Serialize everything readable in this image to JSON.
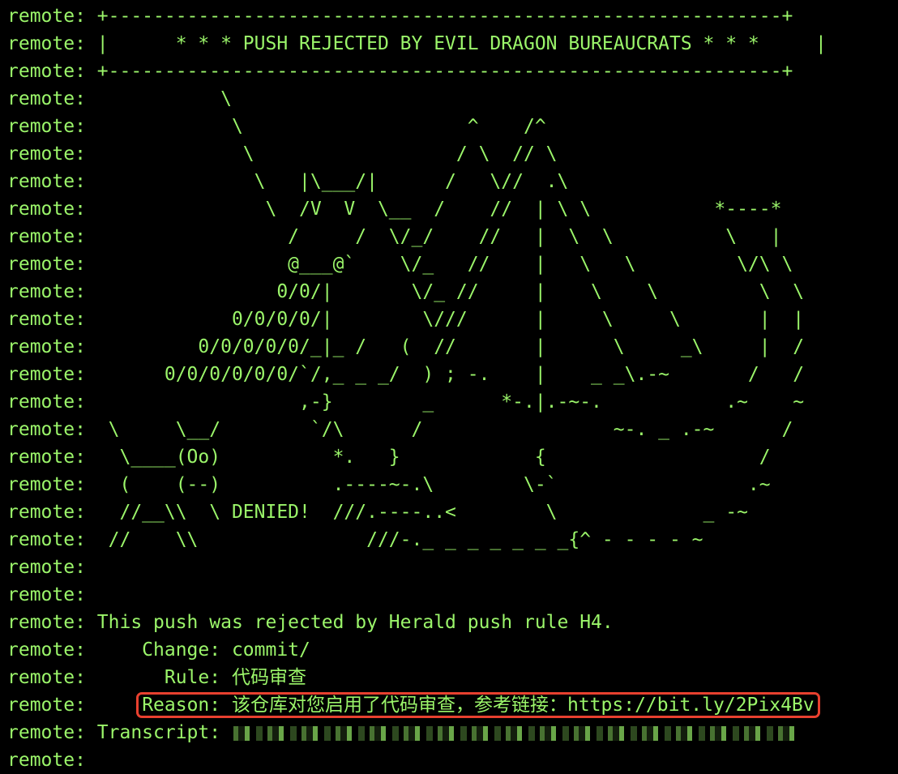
{
  "terminal": {
    "prefix": "remote:",
    "lines": [
      " +------------------------------------------------------------+",
      " |      * * * PUSH REJECTED BY EVIL DRAGON BUREAUCRATS * * *     |",
      " +------------------------------------------------------------+",
      "            \\",
      "             \\                    ^    /^",
      "              \\                  / \\  // \\",
      "               \\   |\\___/|      /   \\//  .\\",
      "                \\  /V  V  \\__  /    //  | \\ \\           *----*",
      "                  /     /  \\/_/    //   |  \\  \\          \\   |",
      "                  @___@`    \\/_   //    |   \\   \\         \\/\\ \\",
      "                 0/0/|       \\/_ //     |    \\    \\         \\  \\",
      "             0/0/0/0/|        \\///      |     \\     \\       |  |",
      "          0/0/0/0/0/_|_ /   (  //       |      \\     _\\     |  /",
      "       0/0/0/0/0/0/`/,_ _ _/  ) ; -.    |    _ _\\.-~       /   /",
      "                   ,-}        _      *-.|.-~-.           .~    ~",
      "  \\     \\__/        `/\\      /                 ~-. _ .-~      /",
      "   \\____(Oo)          *.   }            {                   /",
      "   (    (--)          .----~-.\\        \\-`                 .~",
      "   //__\\\\  \\ DENIED!  ///.----..<        \\             _ -~",
      "  //    \\\\               ///-._ _ _ _ _ _ _{^ - - - - ~",
      "",
      "",
      " This push was rejected by Herald push rule H4.",
      "     Change: commit/",
      "       Rule: 代码审查"
    ],
    "reason_label": "Reason:",
    "reason_text": "该仓库对您启用了代码审查，参考链接：https://bit.ly/2Pix4Bv",
    "transcript_label": " Transcript:",
    "last_line": ""
  },
  "colors": {
    "background": "#000000",
    "text": "#9BF56A",
    "highlight_border": "#E8402F"
  }
}
